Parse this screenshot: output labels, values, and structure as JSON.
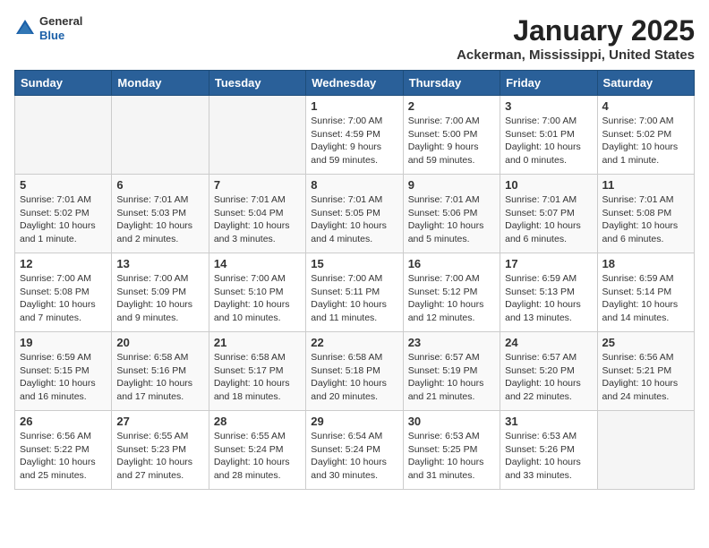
{
  "header": {
    "logo_general": "General",
    "logo_blue": "Blue",
    "month": "January 2025",
    "location": "Ackerman, Mississippi, United States"
  },
  "weekdays": [
    "Sunday",
    "Monday",
    "Tuesday",
    "Wednesday",
    "Thursday",
    "Friday",
    "Saturday"
  ],
  "weeks": [
    [
      {
        "day": "",
        "info": ""
      },
      {
        "day": "",
        "info": ""
      },
      {
        "day": "",
        "info": ""
      },
      {
        "day": "1",
        "info": "Sunrise: 7:00 AM\nSunset: 4:59 PM\nDaylight: 9 hours and 59 minutes."
      },
      {
        "day": "2",
        "info": "Sunrise: 7:00 AM\nSunset: 5:00 PM\nDaylight: 9 hours and 59 minutes."
      },
      {
        "day": "3",
        "info": "Sunrise: 7:00 AM\nSunset: 5:01 PM\nDaylight: 10 hours and 0 minutes."
      },
      {
        "day": "4",
        "info": "Sunrise: 7:00 AM\nSunset: 5:02 PM\nDaylight: 10 hours and 1 minute."
      }
    ],
    [
      {
        "day": "5",
        "info": "Sunrise: 7:01 AM\nSunset: 5:02 PM\nDaylight: 10 hours and 1 minute."
      },
      {
        "day": "6",
        "info": "Sunrise: 7:01 AM\nSunset: 5:03 PM\nDaylight: 10 hours and 2 minutes."
      },
      {
        "day": "7",
        "info": "Sunrise: 7:01 AM\nSunset: 5:04 PM\nDaylight: 10 hours and 3 minutes."
      },
      {
        "day": "8",
        "info": "Sunrise: 7:01 AM\nSunset: 5:05 PM\nDaylight: 10 hours and 4 minutes."
      },
      {
        "day": "9",
        "info": "Sunrise: 7:01 AM\nSunset: 5:06 PM\nDaylight: 10 hours and 5 minutes."
      },
      {
        "day": "10",
        "info": "Sunrise: 7:01 AM\nSunset: 5:07 PM\nDaylight: 10 hours and 6 minutes."
      },
      {
        "day": "11",
        "info": "Sunrise: 7:01 AM\nSunset: 5:08 PM\nDaylight: 10 hours and 6 minutes."
      }
    ],
    [
      {
        "day": "12",
        "info": "Sunrise: 7:00 AM\nSunset: 5:08 PM\nDaylight: 10 hours and 7 minutes."
      },
      {
        "day": "13",
        "info": "Sunrise: 7:00 AM\nSunset: 5:09 PM\nDaylight: 10 hours and 9 minutes."
      },
      {
        "day": "14",
        "info": "Sunrise: 7:00 AM\nSunset: 5:10 PM\nDaylight: 10 hours and 10 minutes."
      },
      {
        "day": "15",
        "info": "Sunrise: 7:00 AM\nSunset: 5:11 PM\nDaylight: 10 hours and 11 minutes."
      },
      {
        "day": "16",
        "info": "Sunrise: 7:00 AM\nSunset: 5:12 PM\nDaylight: 10 hours and 12 minutes."
      },
      {
        "day": "17",
        "info": "Sunrise: 6:59 AM\nSunset: 5:13 PM\nDaylight: 10 hours and 13 minutes."
      },
      {
        "day": "18",
        "info": "Sunrise: 6:59 AM\nSunset: 5:14 PM\nDaylight: 10 hours and 14 minutes."
      }
    ],
    [
      {
        "day": "19",
        "info": "Sunrise: 6:59 AM\nSunset: 5:15 PM\nDaylight: 10 hours and 16 minutes."
      },
      {
        "day": "20",
        "info": "Sunrise: 6:58 AM\nSunset: 5:16 PM\nDaylight: 10 hours and 17 minutes."
      },
      {
        "day": "21",
        "info": "Sunrise: 6:58 AM\nSunset: 5:17 PM\nDaylight: 10 hours and 18 minutes."
      },
      {
        "day": "22",
        "info": "Sunrise: 6:58 AM\nSunset: 5:18 PM\nDaylight: 10 hours and 20 minutes."
      },
      {
        "day": "23",
        "info": "Sunrise: 6:57 AM\nSunset: 5:19 PM\nDaylight: 10 hours and 21 minutes."
      },
      {
        "day": "24",
        "info": "Sunrise: 6:57 AM\nSunset: 5:20 PM\nDaylight: 10 hours and 22 minutes."
      },
      {
        "day": "25",
        "info": "Sunrise: 6:56 AM\nSunset: 5:21 PM\nDaylight: 10 hours and 24 minutes."
      }
    ],
    [
      {
        "day": "26",
        "info": "Sunrise: 6:56 AM\nSunset: 5:22 PM\nDaylight: 10 hours and 25 minutes."
      },
      {
        "day": "27",
        "info": "Sunrise: 6:55 AM\nSunset: 5:23 PM\nDaylight: 10 hours and 27 minutes."
      },
      {
        "day": "28",
        "info": "Sunrise: 6:55 AM\nSunset: 5:24 PM\nDaylight: 10 hours and 28 minutes."
      },
      {
        "day": "29",
        "info": "Sunrise: 6:54 AM\nSunset: 5:24 PM\nDaylight: 10 hours and 30 minutes."
      },
      {
        "day": "30",
        "info": "Sunrise: 6:53 AM\nSunset: 5:25 PM\nDaylight: 10 hours and 31 minutes."
      },
      {
        "day": "31",
        "info": "Sunrise: 6:53 AM\nSunset: 5:26 PM\nDaylight: 10 hours and 33 minutes."
      },
      {
        "day": "",
        "info": ""
      }
    ]
  ]
}
